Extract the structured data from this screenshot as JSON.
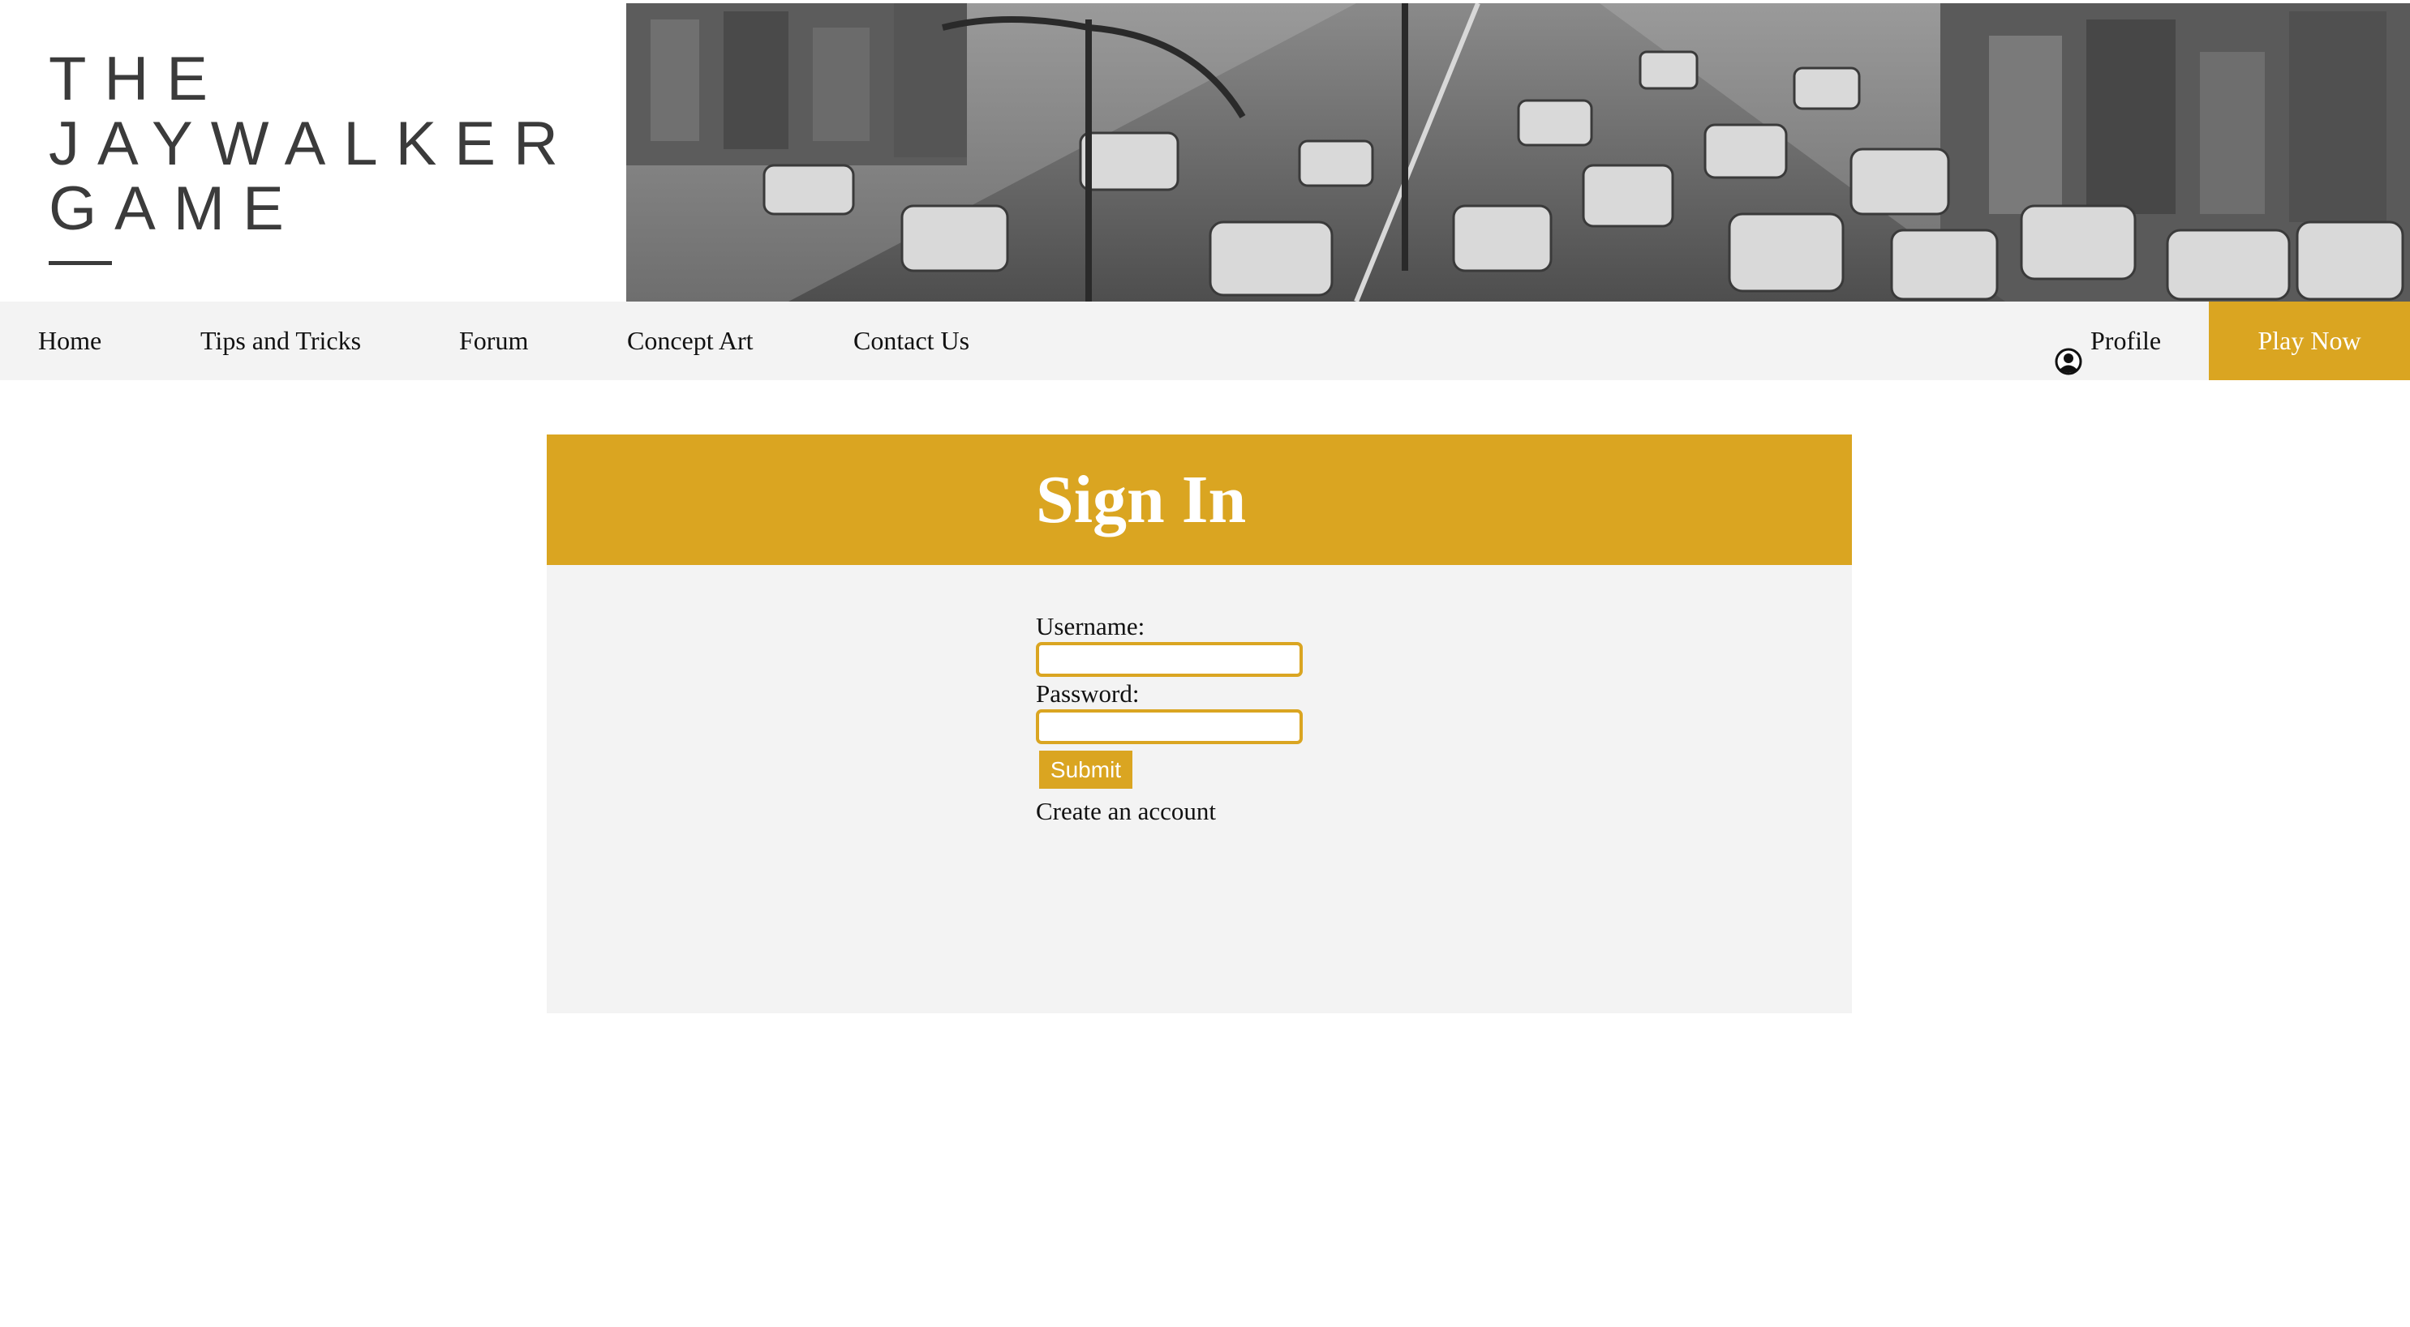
{
  "brand": {
    "logo_line1": "THE",
    "logo_line2": "JAYWALKER",
    "logo_line3": "GAME",
    "accent_color": "#daa521"
  },
  "nav": {
    "home": "Home",
    "tips": "Tips and Tricks",
    "forum": "Forum",
    "concept_art": "Concept Art",
    "contact": "Contact Us",
    "profile": "Profile",
    "profile_icon": "user-circle-icon",
    "play_now": "Play Now"
  },
  "signin": {
    "title": "Sign In",
    "username_label": "Username:",
    "username_value": "",
    "password_label": "Password:",
    "password_value": "",
    "submit_label": "Submit",
    "create_account": "Create an account"
  }
}
